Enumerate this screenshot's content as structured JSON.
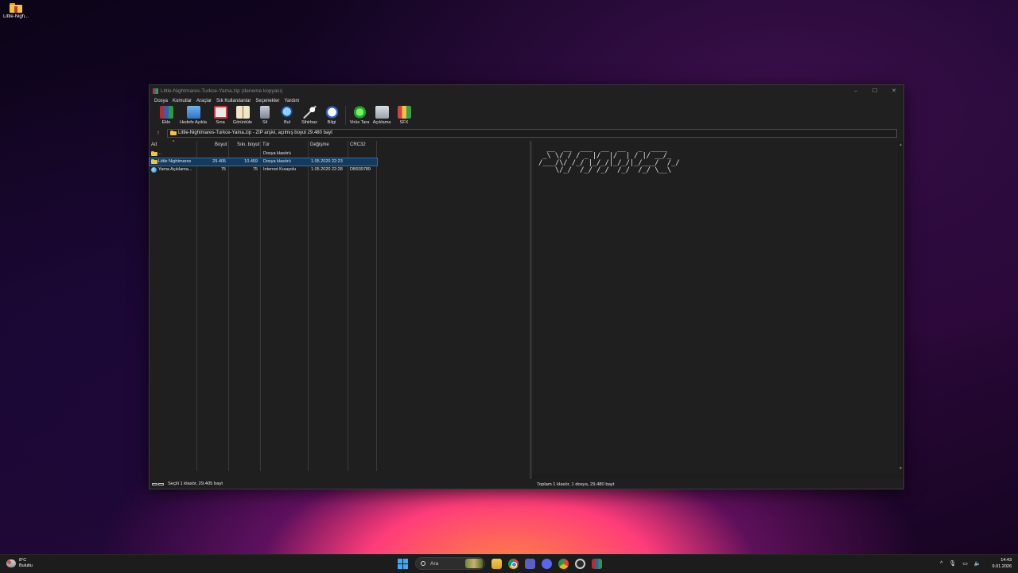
{
  "desktop": {
    "icon_label": "Little-Nigh..."
  },
  "window": {
    "title": "Little-Nightmares-Turkce-Yama.zip (deneme kopyası)",
    "controls": {
      "minimize": "–",
      "maximize": "☐",
      "close": "✕"
    },
    "menu": [
      "Dosya",
      "Komutlar",
      "Araçlar",
      "Sık Kullanılanlar",
      "Seçenekler",
      "Yardım"
    ],
    "toolbar": [
      {
        "label": "Ekle",
        "icon": "add-archive-icon"
      },
      {
        "label": "Hedefe Ayıkla",
        "icon": "extract-folder-icon"
      },
      {
        "label": "Sına",
        "icon": "test-archive-icon"
      },
      {
        "label": "Görüntüle",
        "icon": "view-book-icon"
      },
      {
        "label": "Sil",
        "icon": "trash-icon"
      },
      {
        "label": "Bul",
        "icon": "find-icon"
      },
      {
        "label": "Sihirbaz",
        "icon": "wizard-icon"
      },
      {
        "label": "Bilgi",
        "icon": "info-icon"
      },
      {
        "label": "Virüs Tara",
        "icon": "virus-scan-icon"
      },
      {
        "label": "Açıklama",
        "icon": "comment-icon"
      },
      {
        "label": "SFX",
        "icon": "sfx-icon"
      }
    ],
    "address": {
      "up_arrow": "↑",
      "path": "Little-Nightmares-Turkce-Yama.zip - ZIP arşivi, açılmış boyut 29.480 bayt"
    },
    "columns": [
      "Ad",
      "Boyut",
      "Sıkı. boyut",
      "Tür",
      "Değişme",
      "CRC32"
    ],
    "sort_indicator": "^",
    "rows": [
      {
        "name": "..",
        "size": "",
        "packed": "",
        "type": "Dosya klasörü",
        "modified": "",
        "crc": "",
        "icon": "folder-icon",
        "selected": false
      },
      {
        "name": "Little Nightmares",
        "size": "29.405",
        "packed": "10.459",
        "type": "Dosya klasörü",
        "modified": "1.05.2020 22:23",
        "crc": "",
        "icon": "folder-icon",
        "selected": true
      },
      {
        "name": "Yama Açıklama...",
        "size": "75",
        "packed": "75",
        "type": "Internet Kısayolu",
        "modified": "1.05.2020 22:28",
        "crc": "DB939789",
        "icon": "internet-shortcut-icon",
        "selected": false
      }
    ],
    "ascii_art": [
      "  __  __  ___  __  __   _  ____  ",
      " _\\ \\/ / / _ |/  |/  | / |/ __/_ ",
      "/___/\\/ /_/ |_/_/|_/_/|_/___/  /_/",
      "    \\/_/  /_/ /_/  /_/  /_/ \\__\\  "
    ],
    "status_left": "Seçili 1 klasör, 29.405 bayt",
    "status_right": "Toplam 1 klasör, 1 dosya, 29.480 bayt"
  },
  "taskbar": {
    "weather_temp": "8°C",
    "weather_desc": "Bulutlu",
    "search_placeholder": "Ara",
    "tray_chevron": "^",
    "time": "14:43",
    "date": "9.01.2026"
  }
}
